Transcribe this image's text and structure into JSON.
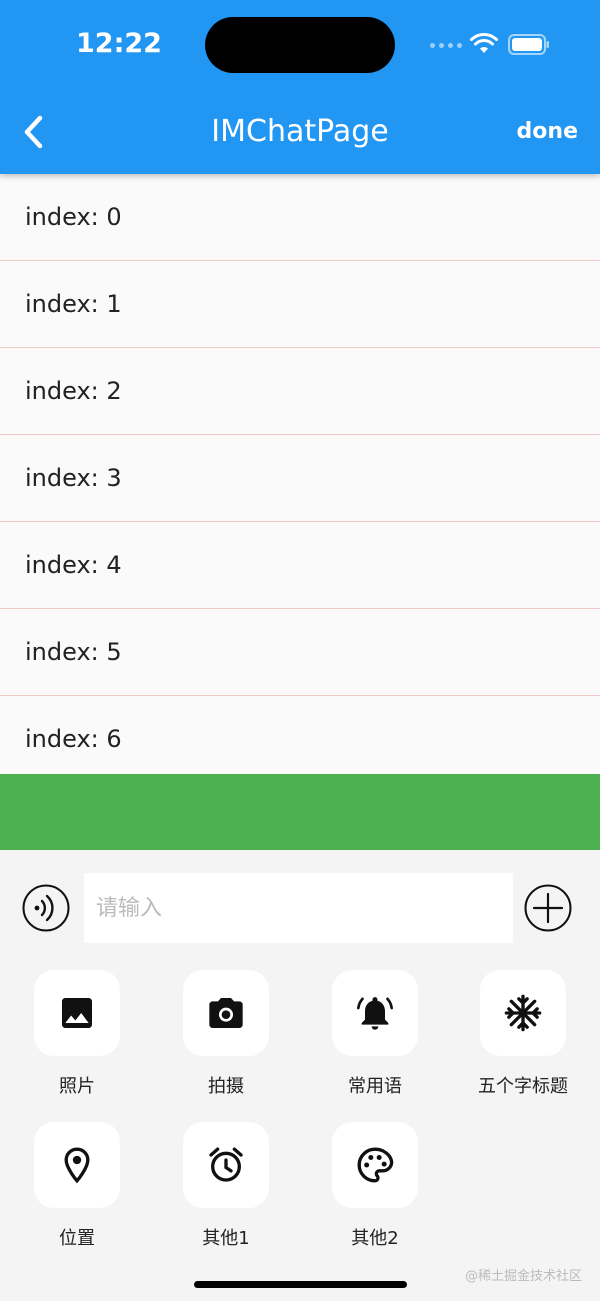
{
  "status_bar": {
    "time": "12:22"
  },
  "app_bar": {
    "title": "IMChatPage",
    "action_label": "done"
  },
  "list": {
    "items": [
      "index: 0",
      "index: 1",
      "index: 2",
      "index: 3",
      "index: 4",
      "index: 5",
      "index: 6"
    ]
  },
  "colors": {
    "app_bar": "#2196f3",
    "green_bar": "#4caf50",
    "divider": "#f1c9c9"
  },
  "input": {
    "placeholder": "请输入",
    "value": ""
  },
  "icons": {
    "back": "chevron-left-icon",
    "voice": "voice-icon",
    "add": "plus-circle-icon"
  },
  "grid": {
    "items": [
      {
        "label": "照片",
        "icon": "image-icon"
      },
      {
        "label": "拍摄",
        "icon": "camera-icon"
      },
      {
        "label": "常用语",
        "icon": "bell-icon"
      },
      {
        "label": "五个字标题",
        "icon": "snowflake-icon"
      },
      {
        "label": "位置",
        "icon": "location-icon"
      },
      {
        "label": "其他1",
        "icon": "alarm-icon"
      },
      {
        "label": "其他2",
        "icon": "palette-icon"
      }
    ]
  },
  "watermark": "@稀土掘金技术社区"
}
